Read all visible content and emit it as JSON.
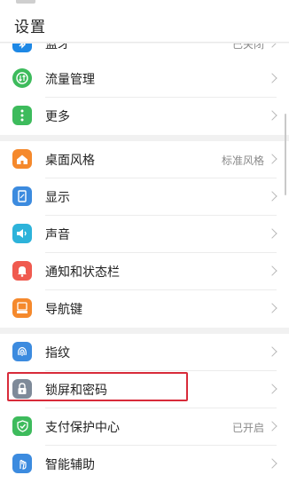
{
  "header": {
    "title": "设置"
  },
  "rows": [
    {
      "name": "row-partial-top",
      "label": "蓝牙",
      "value": "已关闭",
      "icon": "bluetooth-icon",
      "color": "#1E88E5"
    },
    {
      "name": "row-traffic",
      "label": "流量管理",
      "value": "",
      "icon": "traffic-icon",
      "color": "#3DBB5C"
    },
    {
      "name": "row-more",
      "label": "更多",
      "value": "",
      "icon": "more-dots-icon",
      "color": "#3DBB5C"
    },
    {
      "name": "row-desktop-style",
      "label": "桌面风格",
      "value": "标准风格",
      "icon": "home-icon",
      "color": "#F5892C"
    },
    {
      "name": "row-display",
      "label": "显示",
      "value": "",
      "icon": "display-icon",
      "color": "#3C8BDF"
    },
    {
      "name": "row-sound",
      "label": "声音",
      "value": "",
      "icon": "speaker-icon",
      "color": "#2DB3DA"
    },
    {
      "name": "row-notifications",
      "label": "通知和状态栏",
      "value": "",
      "icon": "bell-icon",
      "color": "#F05A4F"
    },
    {
      "name": "row-navigation",
      "label": "导航键",
      "value": "",
      "icon": "navigation-icon",
      "color": "#F5892C"
    },
    {
      "name": "row-fingerprint",
      "label": "指纹",
      "value": "",
      "icon": "fingerprint-icon",
      "color": "#3C8BDF"
    },
    {
      "name": "row-lock-screen",
      "label": "锁屏和密码",
      "value": "",
      "icon": "lock-icon",
      "color": "#7E8A99"
    },
    {
      "name": "row-payment-protection",
      "label": "支付保护中心",
      "value": "已开启",
      "icon": "shield-check-icon",
      "color": "#3DBB5C"
    },
    {
      "name": "row-smart-assist",
      "label": "智能辅助",
      "value": "",
      "icon": "hand-icon",
      "color": "#3C8BDF"
    }
  ],
  "colors": {
    "highlight_box": "#D82B3A",
    "section_gap": "#F1F1F1"
  }
}
